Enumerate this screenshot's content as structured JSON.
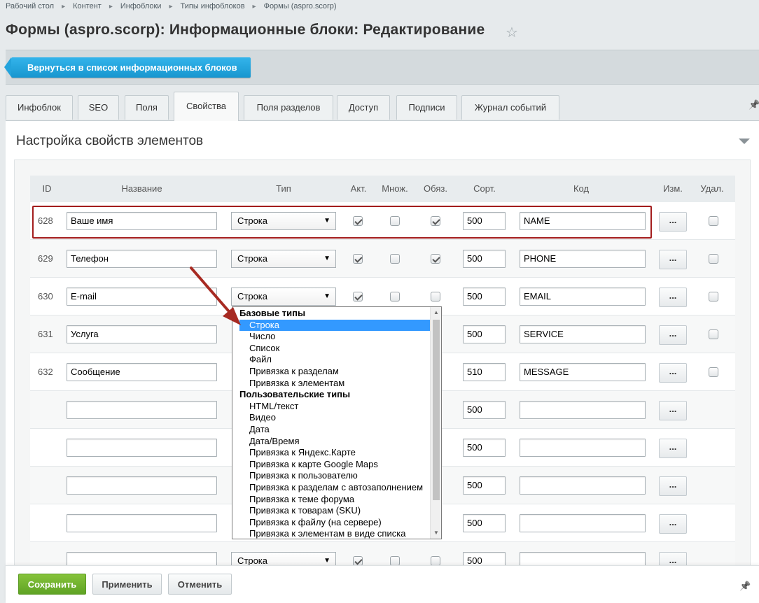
{
  "breadcrumb": [
    "Рабочий стол",
    "Контент",
    "Инфоблоки",
    "Типы инфоблоков",
    "Формы (aspro.scorp)"
  ],
  "page_title": "Формы (aspro.scorp): Информационные блоки: Редактирование",
  "back_button": "Вернуться в список информационных блоков",
  "tabs": [
    "Инфоблок",
    "SEO",
    "Поля",
    "Свойства",
    "Поля разделов",
    "Доступ",
    "Подписи",
    "Журнал событий"
  ],
  "active_tab": "Свойства",
  "section_title": "Настройка свойств элементов",
  "columns": [
    "ID",
    "Название",
    "Тип",
    "Акт.",
    "Множ.",
    "Обяз.",
    "Сорт.",
    "Код",
    "Изм.",
    "Удал."
  ],
  "rows": [
    {
      "id": "628",
      "name": "Ваше имя",
      "type": "Строка",
      "active": true,
      "multiple": false,
      "required": true,
      "sort": "500",
      "code": "NAME",
      "edit": "...",
      "delete": false
    },
    {
      "id": "629",
      "name": "Телефон",
      "type": "Строка",
      "active": true,
      "multiple": false,
      "required": true,
      "sort": "500",
      "code": "PHONE",
      "edit": "...",
      "delete": false
    },
    {
      "id": "630",
      "name": "E-mail",
      "type": "Строка",
      "active": true,
      "multiple": false,
      "required": false,
      "sort": "500",
      "code": "EMAIL",
      "edit": "...",
      "delete": false
    },
    {
      "id": "631",
      "name": "Услуга",
      "type": "",
      "active": null,
      "multiple": null,
      "required": null,
      "sort": "500",
      "code": "SERVICE",
      "edit": "...",
      "delete": false
    },
    {
      "id": "632",
      "name": "Сообщение",
      "type": "",
      "active": null,
      "multiple": null,
      "required": null,
      "sort": "510",
      "code": "MESSAGE",
      "edit": "...",
      "delete": false
    },
    {
      "id": "",
      "name": "",
      "type": "",
      "sort": "500",
      "code": "",
      "edit": "..."
    },
    {
      "id": "",
      "name": "",
      "type": "",
      "sort": "500",
      "code": "",
      "edit": "..."
    },
    {
      "id": "",
      "name": "",
      "type": "",
      "sort": "500",
      "code": "",
      "edit": "..."
    },
    {
      "id": "",
      "name": "",
      "type": "",
      "sort": "500",
      "code": "",
      "edit": "..."
    },
    {
      "id": "",
      "name": "",
      "type": "Строка",
      "active": true,
      "multiple": false,
      "required": false,
      "sort": "500",
      "code": "",
      "edit": "..."
    }
  ],
  "dropdown": {
    "selected": "Строка",
    "groups": [
      {
        "label": "Базовые типы",
        "items": [
          "Строка",
          "Число",
          "Список",
          "Файл",
          "Привязка к разделам",
          "Привязка к элементам"
        ]
      },
      {
        "label": "Пользовательские типы",
        "items": [
          "HTML/текст",
          "Видео",
          "Дата",
          "Дата/Время",
          "Привязка к Яндекс.Карте",
          "Привязка к карте Google Maps",
          "Привязка к пользователю",
          "Привязка к разделам с автозаполнением",
          "Привязка к теме форума",
          "Привязка к товарам (SKU)",
          "Привязка к файлу (на сервере)",
          "Привязка к элементам в виде списка"
        ]
      }
    ]
  },
  "footer": {
    "save": "Сохранить",
    "apply": "Применить",
    "cancel": "Отменить"
  },
  "colors": {
    "accent_blue": "#1e9fd9",
    "save_green": "#6aad2b",
    "highlight_red": "#a31d1d",
    "selected_option": "#3399ff"
  }
}
